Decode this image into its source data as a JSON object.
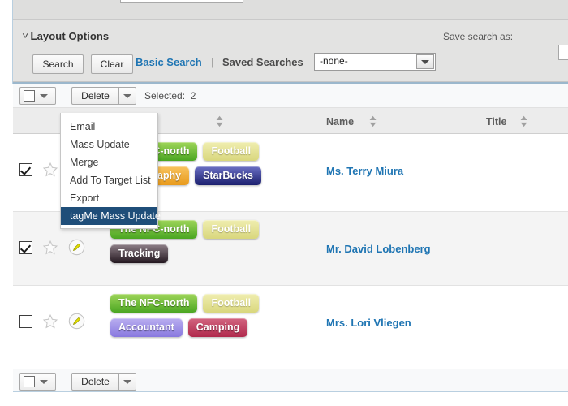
{
  "search_panel": {
    "layout_options_label": "Layout Options",
    "chevron_glyph": "˅",
    "search_button": "Search",
    "clear_button": "Clear",
    "basic_search_link": "Basic Search",
    "separator": "|",
    "saved_searches_label": "Saved Searches",
    "saved_searches_value": "-none-",
    "saved_searches_options": [
      "-none-"
    ],
    "save_search_as_label": "Save search as:",
    "save_search_as_value": "",
    "save_search_as_placeholder": ""
  },
  "massupdate": {
    "delete_label": "Delete",
    "selected_label": "Selected:",
    "selected_count": "2"
  },
  "dropdown": {
    "items": [
      {
        "label": "Email",
        "active": false
      },
      {
        "label": "Mass Update",
        "active": false
      },
      {
        "label": "Merge",
        "active": false
      },
      {
        "label": "Add To Target List",
        "active": false
      },
      {
        "label": "Export",
        "active": false
      },
      {
        "label": "tagMe Mass Update",
        "active": true
      }
    ]
  },
  "columns": {
    "tags_sort_glyph": "sort-icon",
    "name_label": "Name",
    "title_label": "Title"
  },
  "rows": [
    {
      "checked": true,
      "star": "star-icon",
      "pencil": "pencil-icon",
      "name": "Ms. Terry Miura",
      "title": "",
      "tags": [
        {
          "label": "The NFC-north",
          "color_from": "#9fd55a",
          "color_to": "#4aa621",
          "pale": false
        },
        {
          "label": "Football",
          "color_from": "#f0eeb0",
          "color_to": "#d9d77d",
          "pale": true
        },
        {
          "label": "Photography",
          "color_from": "#f8c35e",
          "color_to": "#e89a1c",
          "pale": false
        },
        {
          "label": "StarBucks",
          "color_from": "#6a6fc4",
          "color_to": "#1b1f6e",
          "pale": false
        }
      ]
    },
    {
      "checked": true,
      "star": "star-icon",
      "pencil": "pencil-icon",
      "name": "Mr. David Lobenberg",
      "title": "",
      "tags": [
        {
          "label": "The NFC-north",
          "color_from": "#9fd55a",
          "color_to": "#4aa621",
          "pale": false
        },
        {
          "label": "Football",
          "color_from": "#f0eeb0",
          "color_to": "#d9d77d",
          "pale": true
        },
        {
          "label": "Tracking",
          "color_from": "#8d7f87",
          "color_to": "#241820",
          "pale": false
        }
      ]
    },
    {
      "checked": false,
      "star": "star-icon",
      "pencil": "pencil-icon",
      "name": "Mrs. Lori Vliegen",
      "title": "",
      "tags": [
        {
          "label": "The NFC-north",
          "color_from": "#9fd55a",
          "color_to": "#4aa621",
          "pale": false
        },
        {
          "label": "Football",
          "color_from": "#f0eeb0",
          "color_to": "#d9d77d",
          "pale": true
        },
        {
          "label": "Accountant",
          "color_from": "#b9aef0",
          "color_to": "#8878df",
          "pale": false
        },
        {
          "label": "Camping",
          "color_from": "#d2647f",
          "color_to": "#b0294c",
          "pale": false
        }
      ]
    }
  ],
  "bottom_massupdate": {
    "delete_label": "Delete"
  },
  "colors": {
    "link": "#1f75b3",
    "panel_bg": "#e3e3e2",
    "header_bg": "#ececec",
    "menu_active": "#1f4e79",
    "top_rule": "#9bb7cc"
  }
}
